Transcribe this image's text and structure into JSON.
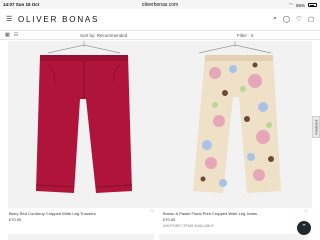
{
  "status": {
    "time": "14:07",
    "date": "Sun 16 Oct",
    "url": "oliverbonas.com",
    "battery": "55%"
  },
  "header": {
    "menu_icon": "hamburger-menu-icon",
    "logo": "OLIVER BONAS"
  },
  "filters": {
    "sort_label": "Sort by: Recommended",
    "filter_label": "Filter · 5"
  },
  "products": [
    {
      "name": "Berry Red Corduroy Cropped Wide Leg Trousers",
      "price": "£70.00",
      "tag": "",
      "color": "#b0143a"
    },
    {
      "name": "Brown & Pastel Floral Print Cropped Wide Leg Jeans",
      "price": "£70.00",
      "tag": "ANOTHER ITEMS AVAILABLE",
      "color": "#efe0c8"
    }
  ],
  "feedback": {
    "label": "Feedback"
  },
  "back_to_top": {
    "glyph": "⌃"
  }
}
